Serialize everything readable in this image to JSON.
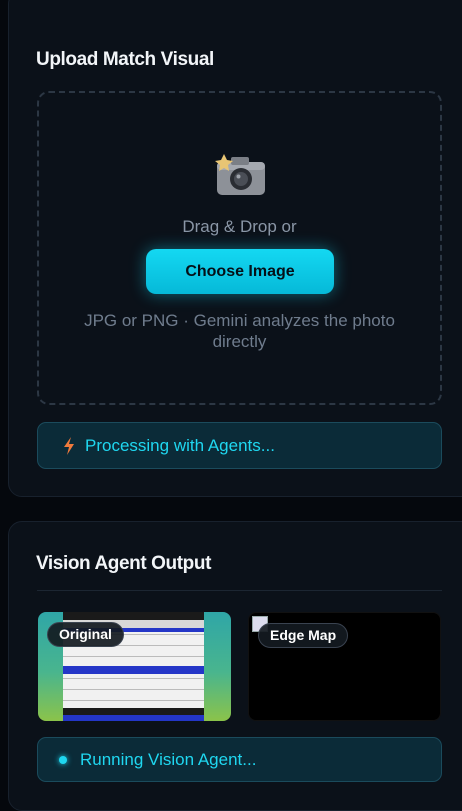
{
  "upload": {
    "title": "Upload Match Visual",
    "drag_text": "Drag & Drop or",
    "choose_label": "Choose Image",
    "hint": "JPG or PNG · Gemini analyzes the photo directly",
    "status": "Processing with Agents..."
  },
  "vision": {
    "title": "Vision Agent Output",
    "original_label": "Original",
    "edge_label": "Edge Map",
    "status": "Running Vision Agent..."
  },
  "icons": {
    "camera": "camera-icon",
    "bolt": "lightning-bolt-icon",
    "dot": "status-dot-icon"
  },
  "colors": {
    "accent": "#1fd7f0",
    "button": "#0fc8e4",
    "card_bg": "#0b1119",
    "page_bg": "#05080d",
    "bolt": "#f07a3c"
  }
}
